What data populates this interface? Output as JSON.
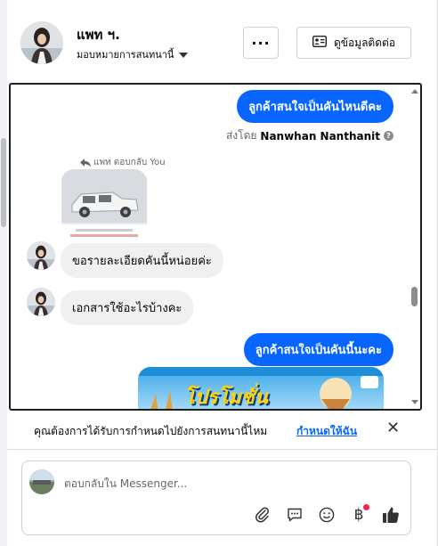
{
  "header": {
    "name": "แพท ฯ.",
    "status_label": "มอบหมายการสนทนานี้",
    "more_label": "···",
    "contact_button_label": "ดูข้อมูลติดต่อ"
  },
  "chat": {
    "messages": {
      "out1": "ลูกค้าสนใจเป็นคันไหนดีคะ",
      "sent_by_prefix": "ส่งโดย",
      "sent_by_name": "Nanwhan Nanthanit",
      "reply_label": "แพท ตอบกลับ You",
      "in1": "ขอรายละเอียดคันนี้หน่อยค่ะ",
      "in2": "เอกสารใช้อะไรบ้างคะ",
      "out2": "ลูกค้าสนใจเป็นคันนี้นะคะ",
      "promo_text": "โปรโมชั่น"
    }
  },
  "notice": {
    "question": "คุณต้องการได้รับการกำหนดไปยังการสนทนานี้ไหม",
    "link": "กำหนดให้ฉัน",
    "close": "✕"
  },
  "composer": {
    "placeholder": "ตอบกลับใน Messenger...",
    "currency_glyph": "฿"
  },
  "colors": {
    "accent": "#0866ff",
    "bubble_in": "#f0f0f0",
    "notification_dot": "#f02849"
  }
}
